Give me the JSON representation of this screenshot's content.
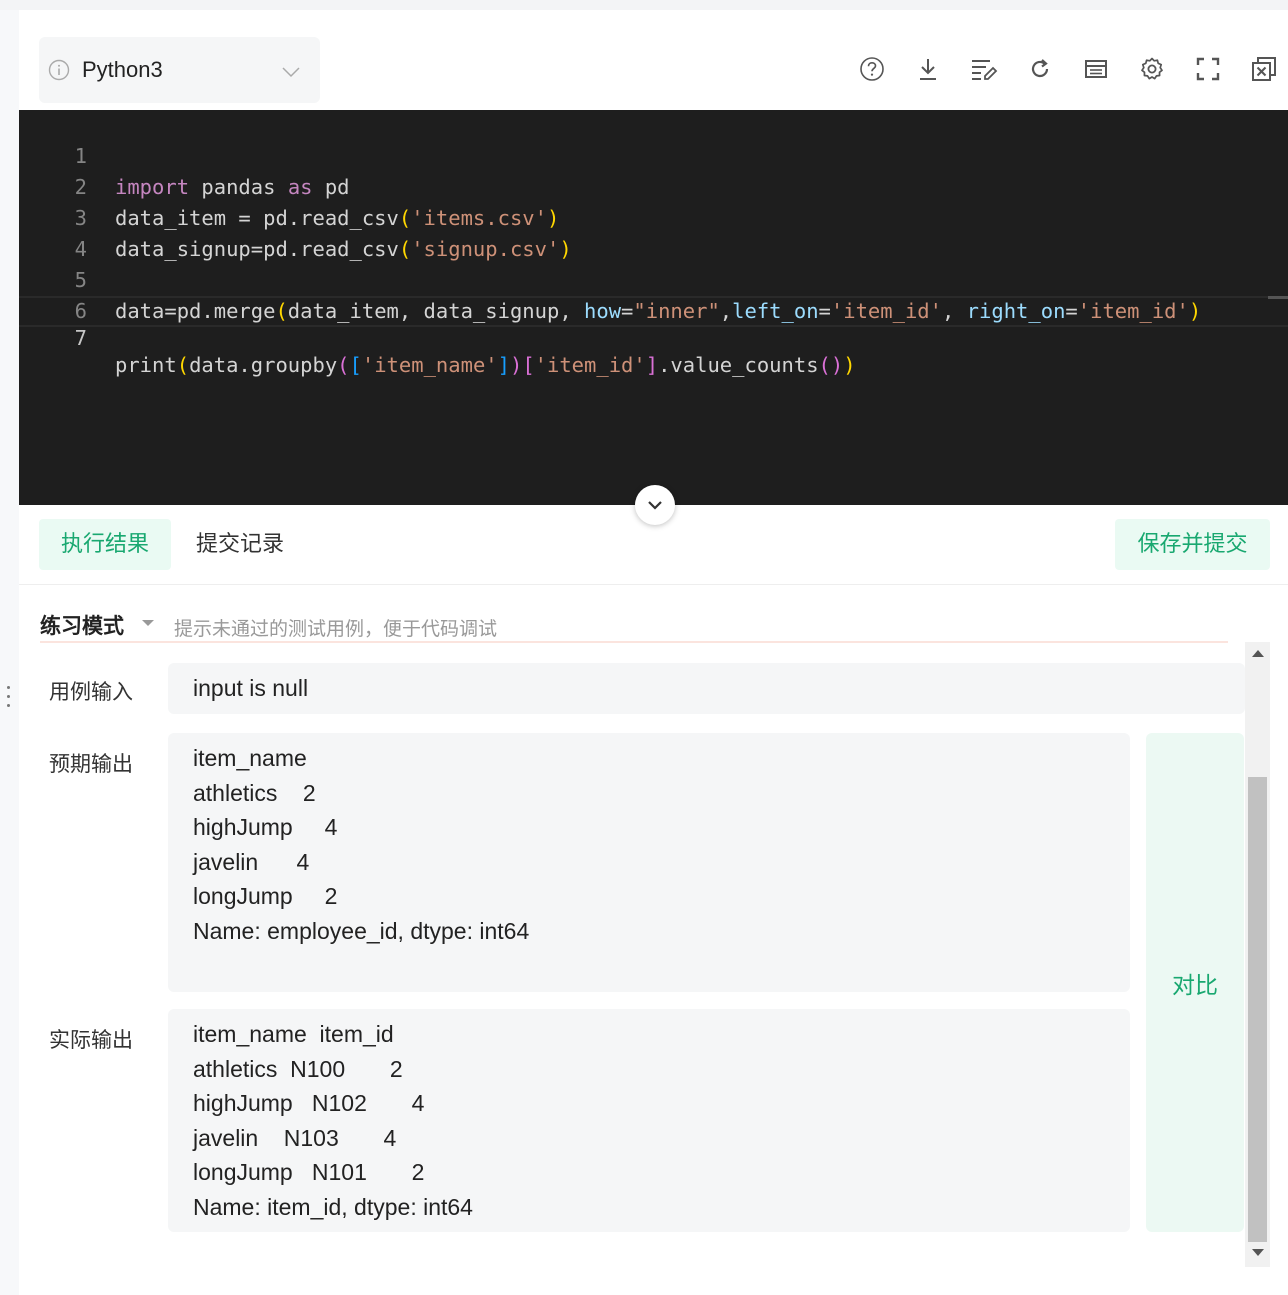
{
  "toolbar": {
    "language": "Python3",
    "icons": [
      "help-icon",
      "download-icon",
      "format-icon",
      "reset-icon",
      "template-icon",
      "settings-icon",
      "fullscreen-icon",
      "close-window-icon"
    ]
  },
  "editor": {
    "line_numbers": [
      "1",
      "2",
      "3",
      "4",
      "5",
      "6",
      "7"
    ],
    "lines": [
      "import pandas as pd",
      "data_item = pd.read_csv('items.csv')",
      "data_signup=pd.read_csv('signup.csv')",
      "",
      "data=pd.merge(data_item, data_signup, how=\"inner\",left_on='item_id', right_on='item_id')",
      "",
      "print(data.groupby(['item_name'])['item_id'].value_counts())"
    ]
  },
  "tabs": {
    "result": "执行结果",
    "history": "提交记录",
    "submit": "保存并提交"
  },
  "mode": {
    "label": "练习模式",
    "hint": "提示未通过的测试用例，便于代码调试"
  },
  "results": {
    "input_label": "用例输入",
    "input_value": "input is null",
    "expected_label": "预期输出",
    "expected_lines": [
      "item_name",
      "athletics    2",
      "highJump     4",
      "javelin      4",
      "longJump     2",
      "Name: employee_id, dtype: int64"
    ],
    "actual_label": "实际输出",
    "actual_lines": [
      "item_name  item_id",
      "athletics  N100       2",
      "highJump   N102       4",
      "javelin    N103       4",
      "longJump   N101       2",
      "Name: item_id, dtype: int64"
    ],
    "compare_label": "对比"
  },
  "colors": {
    "accent": "#19a870",
    "accent_bg": "#eafaf3",
    "editor_bg": "#1e1e1e"
  }
}
